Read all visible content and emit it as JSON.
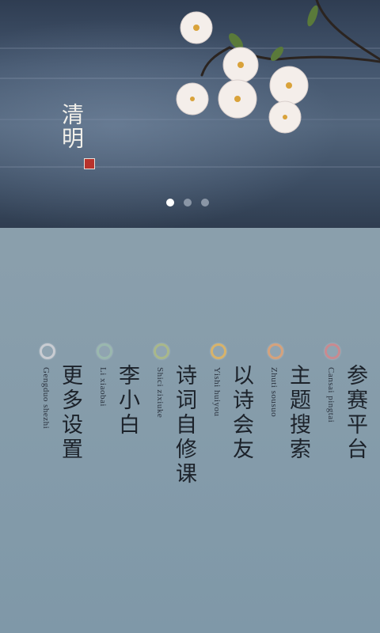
{
  "banner": {
    "title": "清明",
    "carousel": {
      "page_count": 3,
      "active_index": 0
    }
  },
  "menu": {
    "items": [
      {
        "label": "参赛平台",
        "pinyin": "Cansai  pingtai",
        "ring_color": "#c98a90"
      },
      {
        "label": "主题搜索",
        "pinyin": "Zhuti  sousuo",
        "ring_color": "#d5a27c"
      },
      {
        "label": "以诗会友",
        "pinyin": "Yishi  huiyou",
        "ring_color": "#d8b36a"
      },
      {
        "label": "诗词自修课",
        "pinyin": "Shici  zixiuke",
        "ring_color": "#a9b88a"
      },
      {
        "label": "李小白",
        "pinyin": "Li  xiaobai",
        "ring_color": "#9ab8ae"
      },
      {
        "label": "更多设置",
        "pinyin": "Gengduo  shezhi",
        "ring_color": "#c9ccd2"
      }
    ]
  }
}
